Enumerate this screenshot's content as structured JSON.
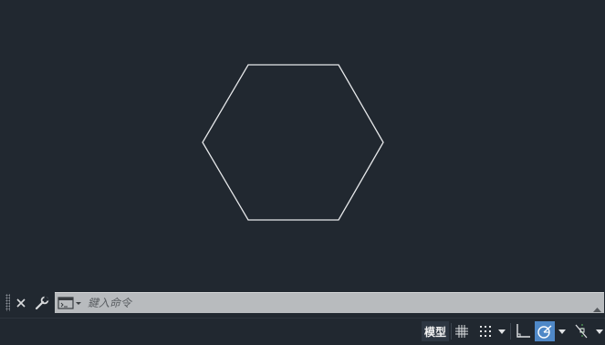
{
  "canvas": {
    "shape": "hexagon",
    "background": "#212830",
    "stroke_color": "#e6e8ea"
  },
  "command_line": {
    "grip_icon": "grip-dots",
    "close_icon": "close-x",
    "customize_icon": "wrench",
    "history_icon": "command-prompt",
    "placeholder": "鍵入命令",
    "value": ""
  },
  "status_bar": {
    "model_label": "模型",
    "buttons": [
      {
        "name": "grid",
        "icon": "grid-hash",
        "active": false
      },
      {
        "name": "snap",
        "icon": "snap-dots",
        "active": false
      },
      {
        "name": "ortho",
        "icon": "ortho-corner",
        "active": false
      },
      {
        "name": "polar",
        "icon": "polar-tracking",
        "active": true
      },
      {
        "name": "osnap",
        "icon": "object-snap-track",
        "active": false
      }
    ],
    "active_color": "#4f88c7"
  }
}
